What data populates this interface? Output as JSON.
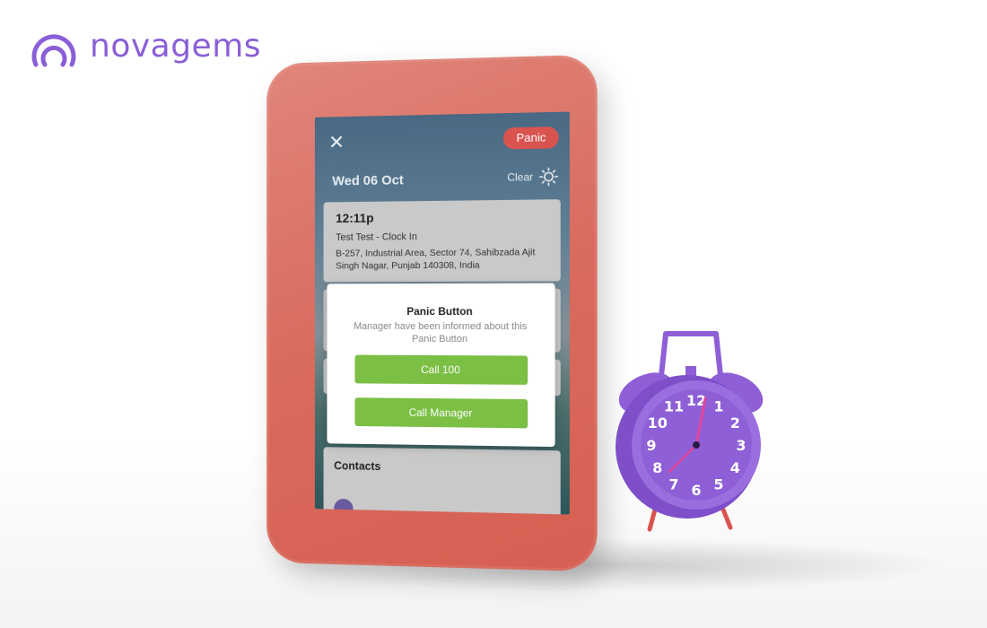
{
  "brand": {
    "name": "novagems",
    "color": "#8a5fd8"
  },
  "device_color": "#d96b5e",
  "app": {
    "panic_label": "Panic",
    "date": "Wed 06 Oct",
    "weather_label": "Clear",
    "weather_icon": "sun-icon",
    "entry": {
      "time": "12:11p",
      "title": "Test Test - Clock In",
      "address": "B-257, Industrial Area, Sector 74, Sahibzada Ajit Singh Nagar, Punjab 140308, India"
    },
    "contacts_title": "Contacts",
    "modal": {
      "title": "Panic Button",
      "message": "Manager have been informed about this Panic Button",
      "call_100_label": "Call 100",
      "call_manager_label": "Call Manager"
    },
    "accent_red": "#d9534f",
    "accent_green": "#7bbf45"
  },
  "clock": {
    "color": "#8e5fd6",
    "numbers": [
      "12",
      "1",
      "2",
      "3",
      "4",
      "5",
      "6",
      "7",
      "8",
      "9",
      "10",
      "11"
    ]
  }
}
